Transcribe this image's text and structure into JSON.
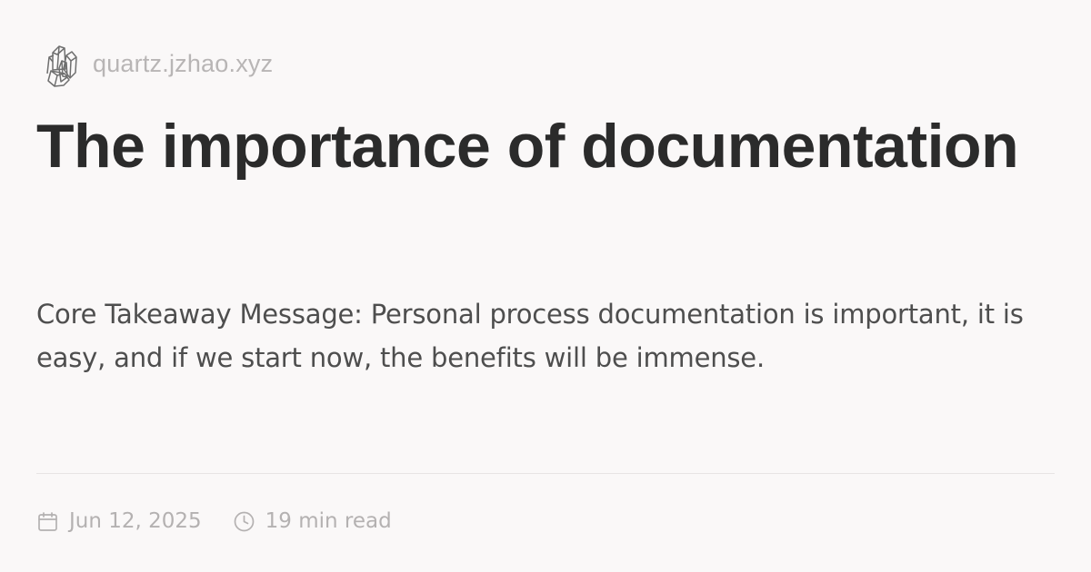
{
  "site": {
    "domain": "quartz.jzhao.xyz",
    "logo_icon": "crystal-logo-icon"
  },
  "article": {
    "title": "The importance of documentation",
    "description": "Core Takeaway Message: Personal process documentation is important, it is easy, and if we start now, the benefits will be immense."
  },
  "meta": {
    "date_icon": "calendar-icon",
    "date": "Jun 12, 2025",
    "reading_time_icon": "clock-icon",
    "reading_time": "19 min read"
  },
  "colors": {
    "background": "#faf8f8",
    "title": "#2b2b2b",
    "body": "#4e4e4e",
    "muted": "#b4b1b1",
    "divider": "#e7e4e4"
  }
}
